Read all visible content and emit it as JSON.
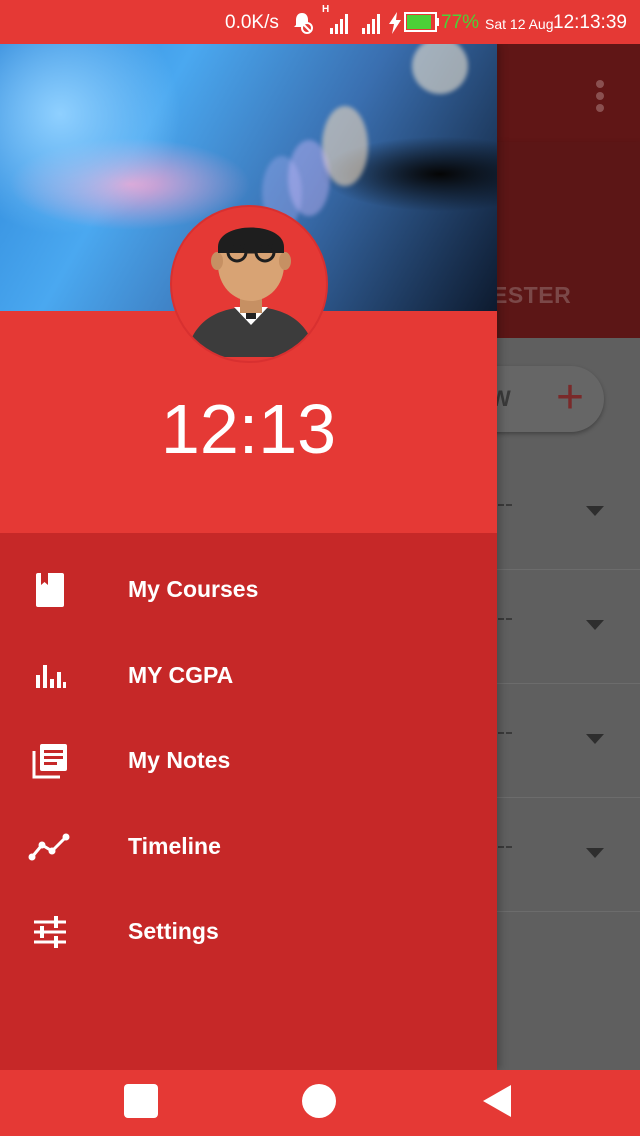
{
  "status_bar": {
    "network_speed": "0.0K/s",
    "network_type": "H",
    "battery_percent": "77%",
    "date": "Sat 12 Aug",
    "time": "12:13:39",
    "battery_color": "#4cd137",
    "icons": [
      "alarm-icon",
      "signal-icon",
      "signal-icon",
      "charging-icon",
      "battery-icon"
    ]
  },
  "drawer": {
    "header_clock": "12:13",
    "header_color": "#e53935",
    "menu_color": "#c62828",
    "menu_items": [
      {
        "label": "My Courses",
        "icon": "book-icon"
      },
      {
        "label": "MY CGPA",
        "icon": "bar-chart-icon"
      },
      {
        "label": "My Notes",
        "icon": "notes-icon"
      },
      {
        "label": "Timeline",
        "icon": "timeline-icon"
      },
      {
        "label": "Settings",
        "icon": "sliders-icon"
      }
    ]
  },
  "background_app": {
    "tab_label_visible": "ESTER",
    "add_button_text_visible": "W",
    "add_button_icon": "plus-icon",
    "rows": [
      {
        "placeholder": "--"
      },
      {
        "placeholder": "--"
      },
      {
        "placeholder": "--"
      },
      {
        "placeholder": "--"
      }
    ]
  },
  "nav_bar": {
    "buttons": [
      "recent-apps-button",
      "home-button",
      "back-button"
    ]
  }
}
